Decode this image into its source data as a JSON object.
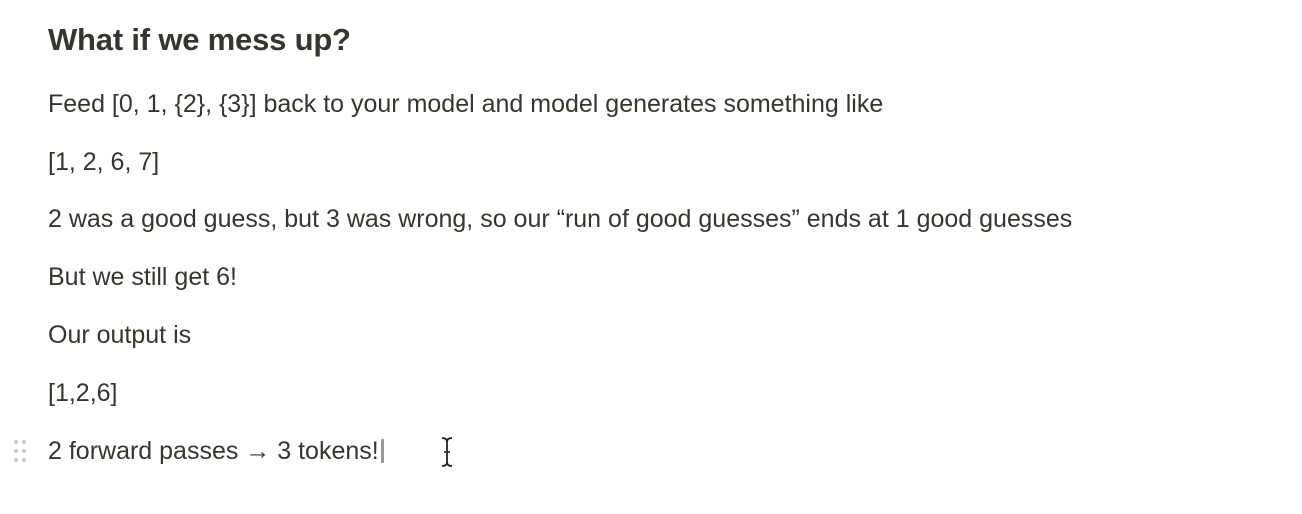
{
  "heading": "What if we mess up?",
  "paragraphs": {
    "p1": "Feed [0, 1, {2}, {3}] back to your model and model generates something like",
    "p2": "[1, 2, 6, 7]",
    "p3": "2 was a good guess, but 3 was wrong, so our “run of good guesses” ends at 1 good guesses",
    "p4": "But we still get 6!",
    "p5": "Our output is",
    "p6": "[1,2,6]",
    "p7": "2 forward passes → 3 tokens!"
  },
  "icons": {
    "drag_handle": "drag-handle-icon",
    "text_cursor": "text-cursor-icon"
  },
  "colors": {
    "text": "#37352f",
    "handle": "#c9c8c5",
    "background": "#ffffff"
  }
}
